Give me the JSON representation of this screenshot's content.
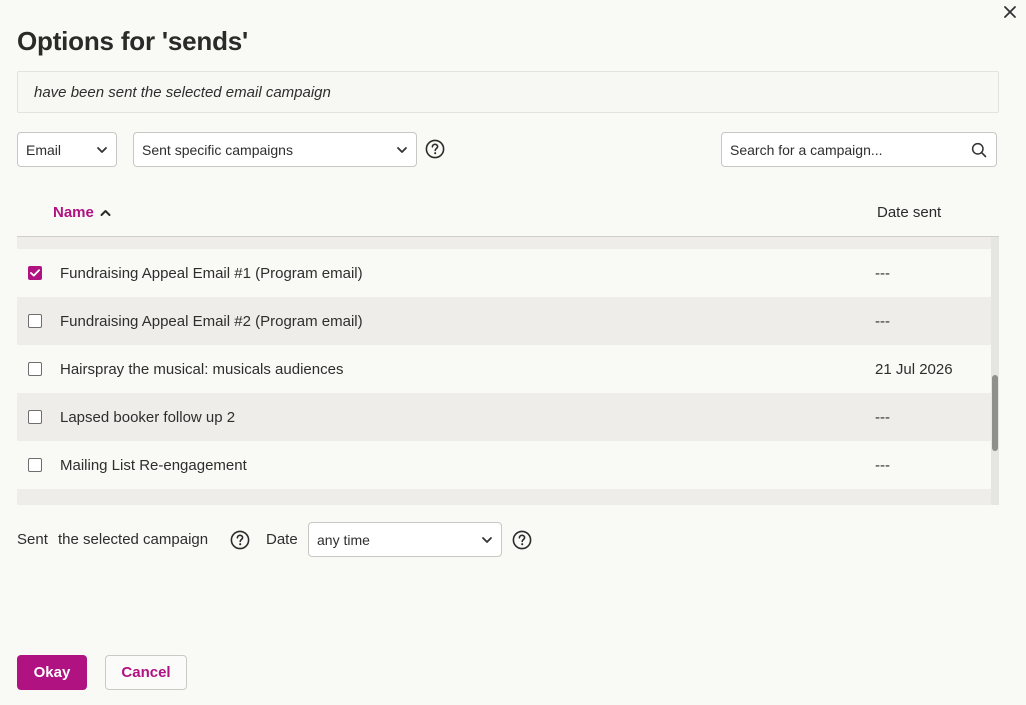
{
  "dialog": {
    "title": "Options for 'sends'",
    "description": "have been sent the selected email campaign"
  },
  "filters": {
    "channel_select": "Email",
    "mode_select": "Sent specific campaigns",
    "search_placeholder": "Search for a campaign..."
  },
  "table": {
    "columns": {
      "name": "Name",
      "date_sent": "Date sent"
    },
    "sort_indicator": "ascending",
    "rows": [
      {
        "name": "Fundraising Appeal Email #1 (Program email)",
        "date_sent": "---",
        "checked": true
      },
      {
        "name": "Fundraising Appeal Email #2 (Program email)",
        "date_sent": "---",
        "checked": false
      },
      {
        "name": "Hairspray the musical: musicals audiences",
        "date_sent": "21 Jul 2026",
        "checked": false
      },
      {
        "name": "Lapsed booker follow up 2",
        "date_sent": "---",
        "checked": false
      },
      {
        "name": "Mailing List Re-engagement",
        "date_sent": "---",
        "checked": false
      }
    ]
  },
  "criteria": {
    "sent_label": "Sent",
    "campaign_label": "the selected campaign",
    "date_label": "Date",
    "date_select": "any time"
  },
  "actions": {
    "okay": "Okay",
    "cancel": "Cancel"
  },
  "icons": {
    "close": "close-icon",
    "chevron": "chevron-down-icon",
    "help": "question-circle-icon",
    "search": "search-icon",
    "sort": "chevron-up-icon",
    "check": "check-icon"
  },
  "colors": {
    "accent": "#b01282",
    "row_alt": "#eeedea",
    "background": "#f9f9f6"
  }
}
